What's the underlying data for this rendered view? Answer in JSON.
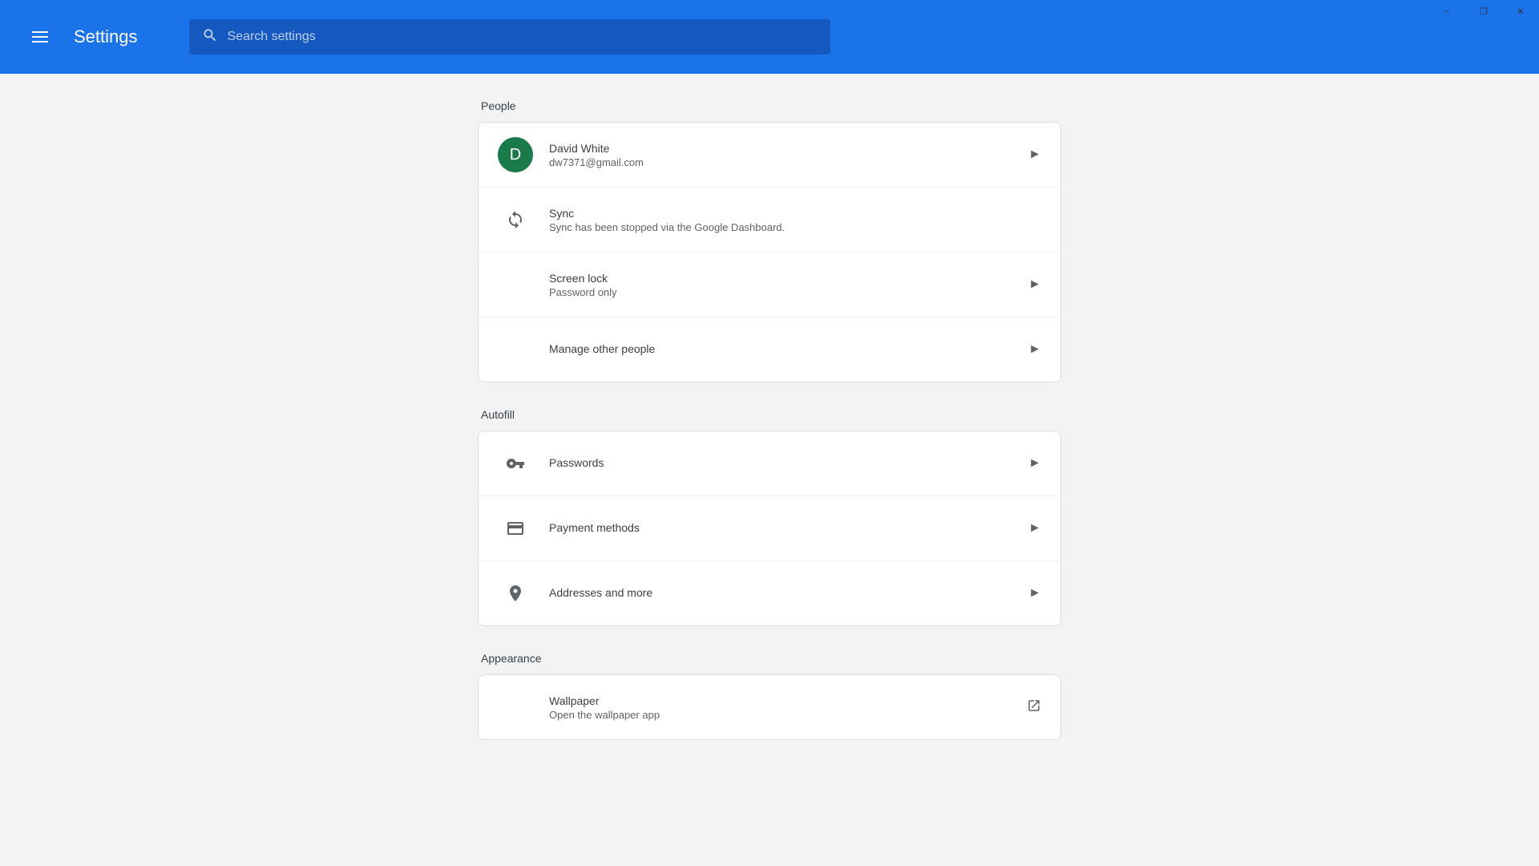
{
  "titlebar": {
    "minimize_label": "–",
    "maximize_label": "❐",
    "close_label": "✕"
  },
  "header": {
    "menu_icon": "menu",
    "title": "Settings",
    "search_placeholder": "Search settings"
  },
  "sections": [
    {
      "id": "people",
      "title": "People",
      "rows": [
        {
          "id": "account",
          "type": "avatar",
          "avatar_letter": "D",
          "title": "David White",
          "subtitle": "dw7371@gmail.com",
          "action": "chevron"
        },
        {
          "id": "sync",
          "type": "icon",
          "icon": "sync",
          "title": "Sync",
          "subtitle": "Sync has been stopped via the Google Dashboard.",
          "action": "none"
        },
        {
          "id": "screen-lock",
          "type": "none",
          "title": "Screen lock",
          "subtitle": "Password only",
          "action": "chevron"
        },
        {
          "id": "manage-other-people",
          "type": "none",
          "title": "Manage other people",
          "subtitle": "",
          "action": "chevron"
        }
      ]
    },
    {
      "id": "autofill",
      "title": "Autofill",
      "rows": [
        {
          "id": "passwords",
          "type": "icon",
          "icon": "key",
          "title": "Passwords",
          "subtitle": "",
          "action": "chevron"
        },
        {
          "id": "payment-methods",
          "type": "icon",
          "icon": "card",
          "title": "Payment methods",
          "subtitle": "",
          "action": "chevron"
        },
        {
          "id": "addresses",
          "type": "icon",
          "icon": "pin",
          "title": "Addresses and more",
          "subtitle": "",
          "action": "chevron"
        }
      ]
    },
    {
      "id": "appearance",
      "title": "Appearance",
      "rows": [
        {
          "id": "wallpaper",
          "type": "none",
          "title": "Wallpaper",
          "subtitle": "Open the wallpaper app",
          "action": "external"
        }
      ]
    }
  ],
  "colors": {
    "header_bg": "#1a73e8",
    "search_bg": "#1558c0",
    "avatar_bg": "#1a7a4a"
  }
}
